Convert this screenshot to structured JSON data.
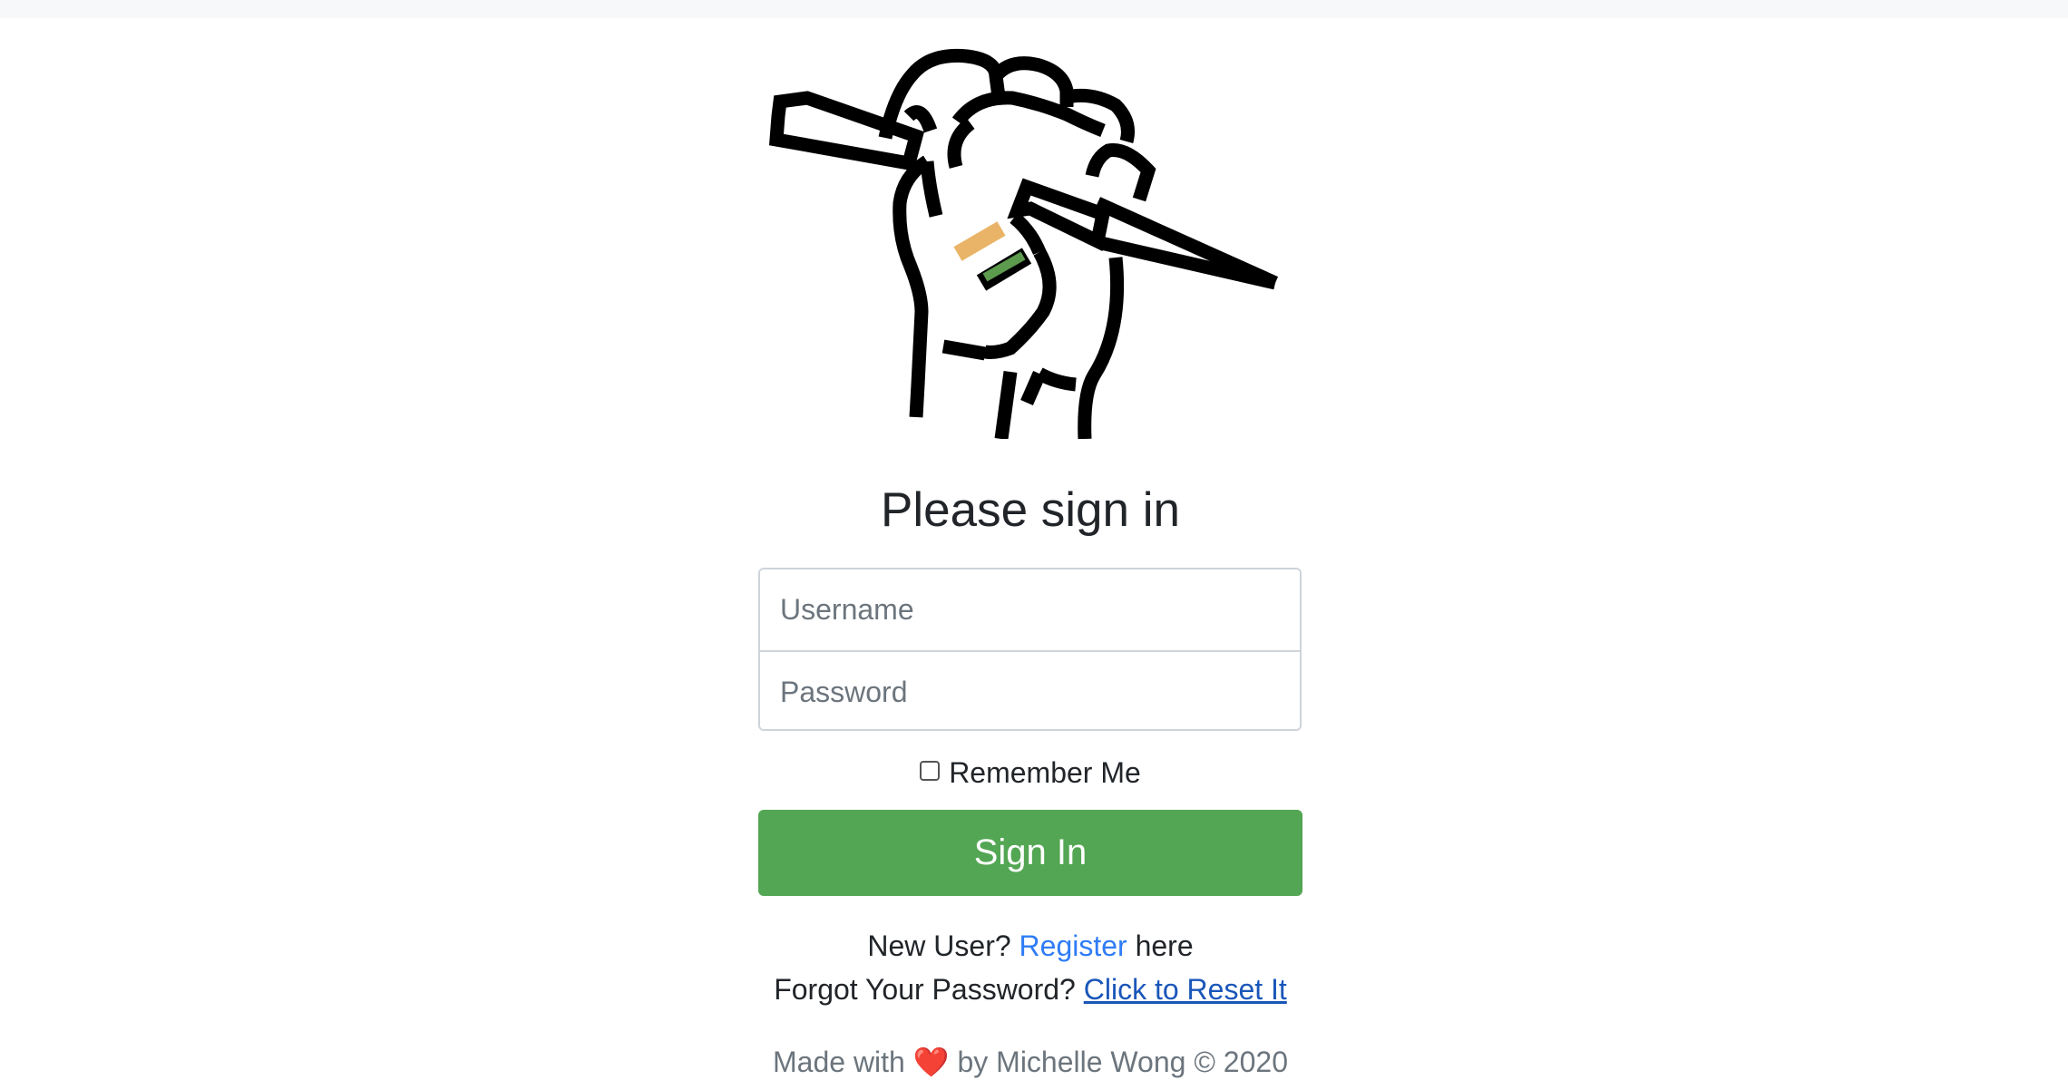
{
  "page": {
    "title": "Please sign in"
  },
  "logo": {
    "icon": "fist-holding-pen-logo",
    "colors": {
      "line": "#000000",
      "saffron": "#e9b467",
      "green": "#5c9a4e"
    }
  },
  "form": {
    "username_placeholder": "Username",
    "password_placeholder": "Password",
    "remember_label": "Remember Me",
    "remember_checked": false,
    "submit_label": "Sign In",
    "submit_color": "#53a653"
  },
  "links": {
    "new_user_prefix": "New User?",
    "register_label": "Register",
    "new_user_suffix": "here",
    "forgot_prefix": "Forgot Your Password?",
    "reset_label": "Click to Reset It"
  },
  "footer": {
    "made_with": "Made with",
    "heart": "❤️",
    "credit": "by Michelle Wong © 2020"
  }
}
